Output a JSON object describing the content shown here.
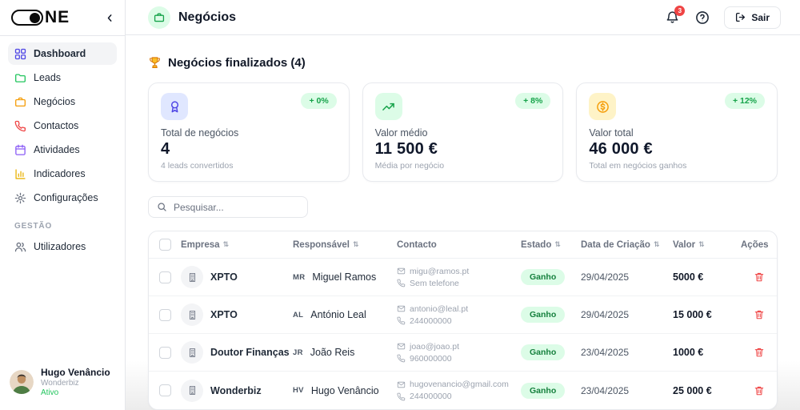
{
  "sidebar": {
    "logo_text": "NE",
    "section_label": "GESTÃO",
    "items": [
      {
        "label": "Dashboard",
        "icon": "dashboard-grid-icon",
        "color": "#4f46e5",
        "active": true
      },
      {
        "label": "Leads",
        "icon": "leads-folder-icon",
        "color": "#22c55e",
        "active": false
      },
      {
        "label": "Negócios",
        "icon": "deals-briefcase-icon",
        "color": "#f59e0b",
        "active": false
      },
      {
        "label": "Contactos",
        "icon": "contacts-phone-icon",
        "color": "#ef4444",
        "active": false
      },
      {
        "label": "Atividades",
        "icon": "activities-calendar-icon",
        "color": "#8b5cf6",
        "active": false
      },
      {
        "label": "Indicadores",
        "icon": "indicators-chart-icon",
        "color": "#eab308",
        "active": false
      },
      {
        "label": "Configurações",
        "icon": "settings-gear-icon",
        "color": "#6b7280",
        "active": false
      }
    ],
    "management_items": [
      {
        "label": "Utilizadores",
        "icon": "users-icon",
        "color": "#6b7280",
        "active": false
      }
    ],
    "user": {
      "name": "Hugo Venâncio",
      "company": "Wonderbiz",
      "status": "Ativo"
    }
  },
  "header": {
    "title": "Negócios",
    "title_icon": "briefcase-icon",
    "notification_count": "3",
    "logout_label": "Sair"
  },
  "main": {
    "section_title": "Negócios finalizados (4)",
    "cards": [
      {
        "label": "Total de negócios",
        "value": "4",
        "subtext": "4 leads convertidos",
        "badge": "+ 0%",
        "icon": "award-icon",
        "icon_color": "#4f46e5",
        "icon_bg": "#e0e7ff"
      },
      {
        "label": "Valor médio",
        "value": "11 500 €",
        "subtext": "Média por negócio",
        "badge": "+ 8%",
        "icon": "trending-up-icon",
        "icon_color": "#16a34a",
        "icon_bg": "#dcfce7"
      },
      {
        "label": "Valor total",
        "value": "46 000 €",
        "subtext": "Total em negócios ganhos",
        "badge": "+ 12%",
        "icon": "coin-icon",
        "icon_color": "#f59e0b",
        "icon_bg": "#fef3c7"
      }
    ],
    "search": {
      "placeholder": "Pesquisar..."
    },
    "table": {
      "sort_glyph": "⇅",
      "columns": [
        {
          "label": "Empresa",
          "sortable": true
        },
        {
          "label": "Responsável",
          "sortable": true
        },
        {
          "label": "Contacto",
          "sortable": false
        },
        {
          "label": "Estado",
          "sortable": true
        },
        {
          "label": "Data de Criação",
          "sortable": true
        },
        {
          "label": "Valor",
          "sortable": true
        },
        {
          "label": "Ações",
          "sortable": false
        }
      ],
      "rows": [
        {
          "company": "XPTO",
          "initials": "MR",
          "responsible": "Miguel Ramos",
          "email": "migu@ramos.pt",
          "phone": "Sem telefone",
          "status": "Ganho",
          "date": "29/04/2025",
          "value": "5000 €"
        },
        {
          "company": "XPTO",
          "initials": "AL",
          "responsible": "António Leal",
          "email": "antonio@leal.pt",
          "phone": "244000000",
          "status": "Ganho",
          "date": "29/04/2025",
          "value": "15 000 €"
        },
        {
          "company": "Doutor Finanças",
          "initials": "JR",
          "responsible": "João Reis",
          "email": "joao@joao.pt",
          "phone": "960000000",
          "status": "Ganho",
          "date": "23/04/2025",
          "value": "1000 €"
        },
        {
          "company": "Wonderbiz",
          "initials": "HV",
          "responsible": "Hugo Venâncio",
          "email": "hugovenancio@gmail.com",
          "phone": "244000000",
          "status": "Ganho",
          "date": "23/04/2025",
          "value": "25 000 €"
        }
      ]
    }
  },
  "colors": {
    "accent_green": "#16a34a",
    "badge_bg": "#dcfce7",
    "status_text": "#15803d",
    "danger": "#ef4444",
    "border": "#e5e7eb",
    "active_item_bg": "#f3f4f6"
  }
}
